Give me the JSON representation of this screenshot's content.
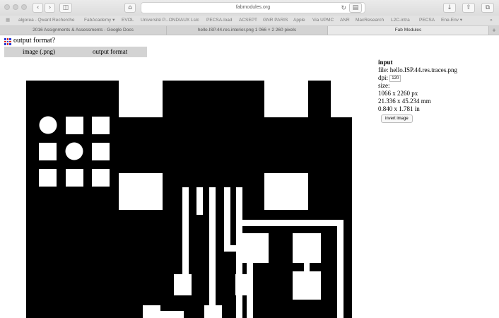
{
  "browser": {
    "url": "fabmodules.org",
    "bookmarks": [
      "algorea - Qwant Recherche",
      "FabAcademy ▾",
      "EVOL",
      "Université P...ONDIAUX Lslc",
      "PECSA-load",
      "ACSEPT",
      "GNR PARIS",
      "Apple",
      "Via UPMC",
      "ANR",
      "MacResearch",
      "L2C-intra",
      "PECSA",
      "Ene-Env ▾"
    ],
    "tabs": [
      {
        "label": "2016 Assignments & Assessments - Google Docs",
        "active": false
      },
      {
        "label": "hello.ISP.44.res.interior.png 1 066 × 2 260 pixels",
        "active": false
      },
      {
        "label": "Fab Modules",
        "active": true
      }
    ]
  },
  "page": {
    "output_format_title": "output format?",
    "format_option": "image (.png)",
    "format_label": "output format"
  },
  "input_panel": {
    "title": "input",
    "file": "file: hello.ISP.44.res.traces.png",
    "dpi_label": "dpi:",
    "dpi_value": "120",
    "size_label": "size:",
    "size_px": "1066 x 2260 px",
    "size_mm": "21.336 x 45.234 mm",
    "size_in": "0.840 x 1.781 in",
    "invert_button": "invert image"
  },
  "colors": {
    "trace": "#ffffff",
    "board": "#000000",
    "logo_blue": "#2a3bd8",
    "logo_red": "#d52a2a"
  }
}
